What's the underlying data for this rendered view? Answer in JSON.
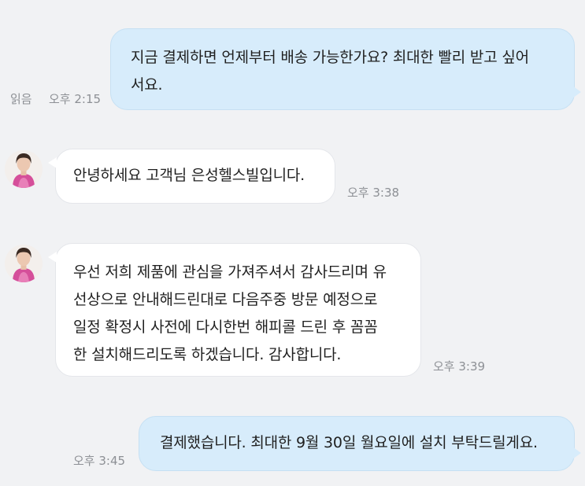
{
  "messages": [
    {
      "type": "sent",
      "lines": [
        "지금 결제하면 언제부터 배송 가능한가요? 최대한 빨리 받고 싶어",
        "서요."
      ],
      "read_label": "읽음",
      "time": "오후 2:15"
    },
    {
      "type": "received",
      "lines": [
        "안녕하세요 고객님 은성헬스빌입니다."
      ],
      "time": "오후 3:38"
    },
    {
      "type": "received",
      "lines": [
        "우선 저희 제품에 관심을 가져주셔서 감사드리며 유",
        "선상으로 안내해드린대로 다음주중 방문 예정으로",
        "일정 확정시 사전에 다시한번 해피콜 드린 후 꼼꼼",
        "한 설치해드리도록 하겠습니다. 감사합니다."
      ],
      "time": "오후 3:39"
    },
    {
      "type": "sent",
      "lines": [
        "결제했습니다. 최대한 9월 30일 월요일에 설치 부탁드릴게요."
      ],
      "time": "오후 3:45"
    }
  ],
  "colors": {
    "background": "#f1f2f4",
    "sent_bubble": "#d7ecfb",
    "received_bubble": "#ffffff",
    "timestamp": "#8d9095"
  },
  "icons": {
    "avatar": "agent-profile-avatar"
  }
}
